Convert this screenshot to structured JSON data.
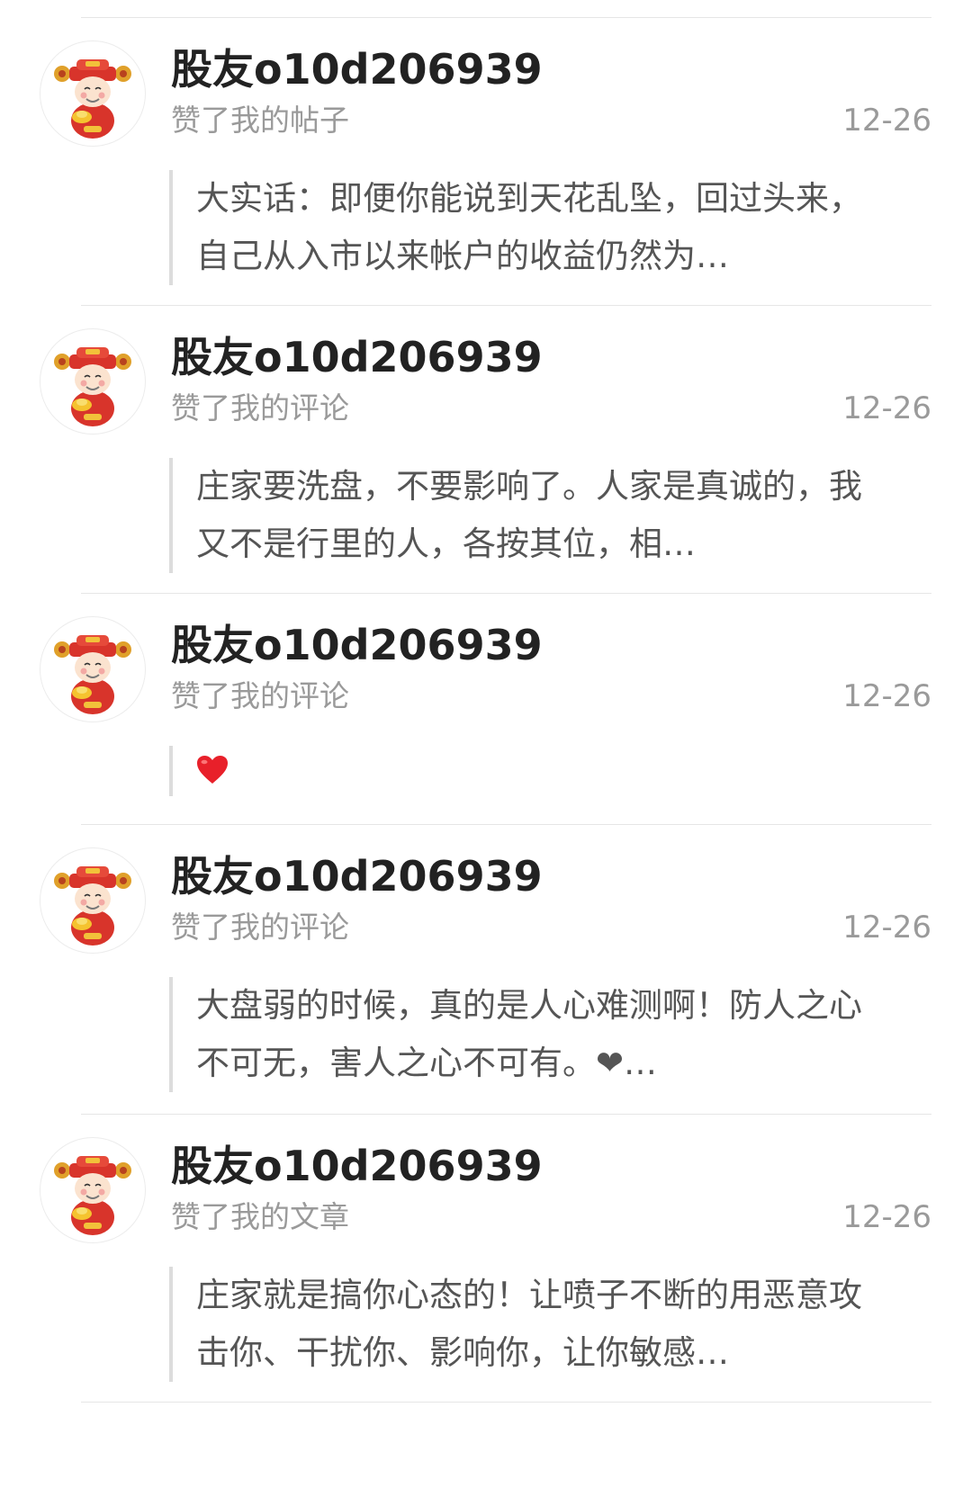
{
  "notifications": [
    {
      "username": "股友o10d206939",
      "action": "赞了我的帖子",
      "date": "12-26",
      "content": "大实话：即便你能说到天花乱坠，回过头来，自己从入市以来帐户的收益仍然为…",
      "avatar_icon": "god-of-wealth-avatar-icon"
    },
    {
      "username": "股友o10d206939",
      "action": "赞了我的评论",
      "date": "12-26",
      "content": "庄家要洗盘，不要影响了。人家是真诚的，我又不是行里的人，各按其位，相…",
      "avatar_icon": "god-of-wealth-avatar-icon"
    },
    {
      "username": "股友o10d206939",
      "action": "赞了我的评论",
      "date": "12-26",
      "content": "",
      "content_icon": "heart-emoji-icon",
      "avatar_icon": "god-of-wealth-avatar-icon"
    },
    {
      "username": "股友o10d206939",
      "action": "赞了我的评论",
      "date": "12-26",
      "content": "大盘弱的时候，真的是人心难测啊！防人之心不可无，害人之心不可有。❤…",
      "avatar_icon": "god-of-wealth-avatar-icon"
    },
    {
      "username": "股友o10d206939",
      "action": "赞了我的文章",
      "date": "12-26",
      "content": "庄家就是搞你心态的！让喷子不断的用恶意攻击你、干扰你、影响你，让你敏感…",
      "avatar_icon": "god-of-wealth-avatar-icon"
    }
  ],
  "colors": {
    "username": "#222222",
    "secondary_text": "#9a9a9a",
    "quote_text": "#555555",
    "quote_bar": "#dcdcdc",
    "divider": "#e6e6e6",
    "heart": "#e8202a"
  }
}
